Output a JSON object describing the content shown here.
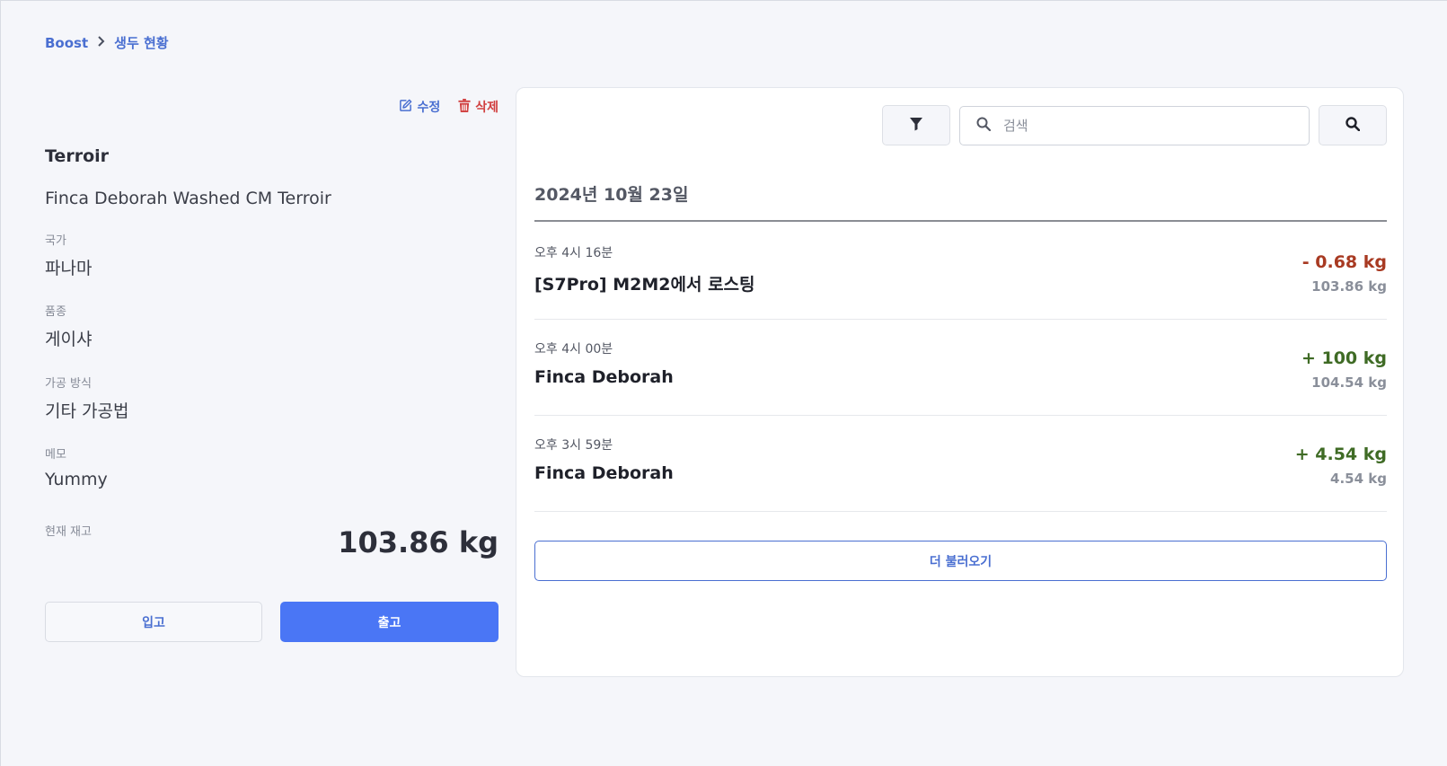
{
  "breadcrumb": {
    "root": "Boost",
    "current": "생두 현황"
  },
  "detail": {
    "edit_label": "수정",
    "delete_label": "삭제",
    "title": "Terroir",
    "name": "Finca Deborah Washed CM Terroir",
    "country_label": "국가",
    "country": "파나마",
    "variety_label": "품종",
    "variety": "게이샤",
    "process_label": "가공 방식",
    "process": "기타 가공법",
    "memo_label": "메모",
    "memo": "Yummy",
    "stock_label": "현재 재고",
    "stock": "103.86 kg",
    "in_label": "입고",
    "out_label": "출고"
  },
  "history": {
    "search_placeholder": "검색",
    "date": "2024년 10월 23일",
    "entries": [
      {
        "time": "오후 4시 16분",
        "name": "[S7Pro] M2M2에서 로스팅",
        "delta": "- 0.68 kg",
        "total": "103.86 kg",
        "delta_color": "#a83a22"
      },
      {
        "time": "오후 4시 00분",
        "name": "Finca Deborah",
        "delta": "+ 100 kg",
        "total": "104.54 kg",
        "delta_color": "#3f6b25"
      },
      {
        "time": "오후 3시 59분",
        "name": "Finca Deborah",
        "delta": "+ 4.54 kg",
        "total": "4.54 kg",
        "delta_color": "#3f6b25"
      }
    ],
    "load_more_label": "더 불러오기"
  }
}
